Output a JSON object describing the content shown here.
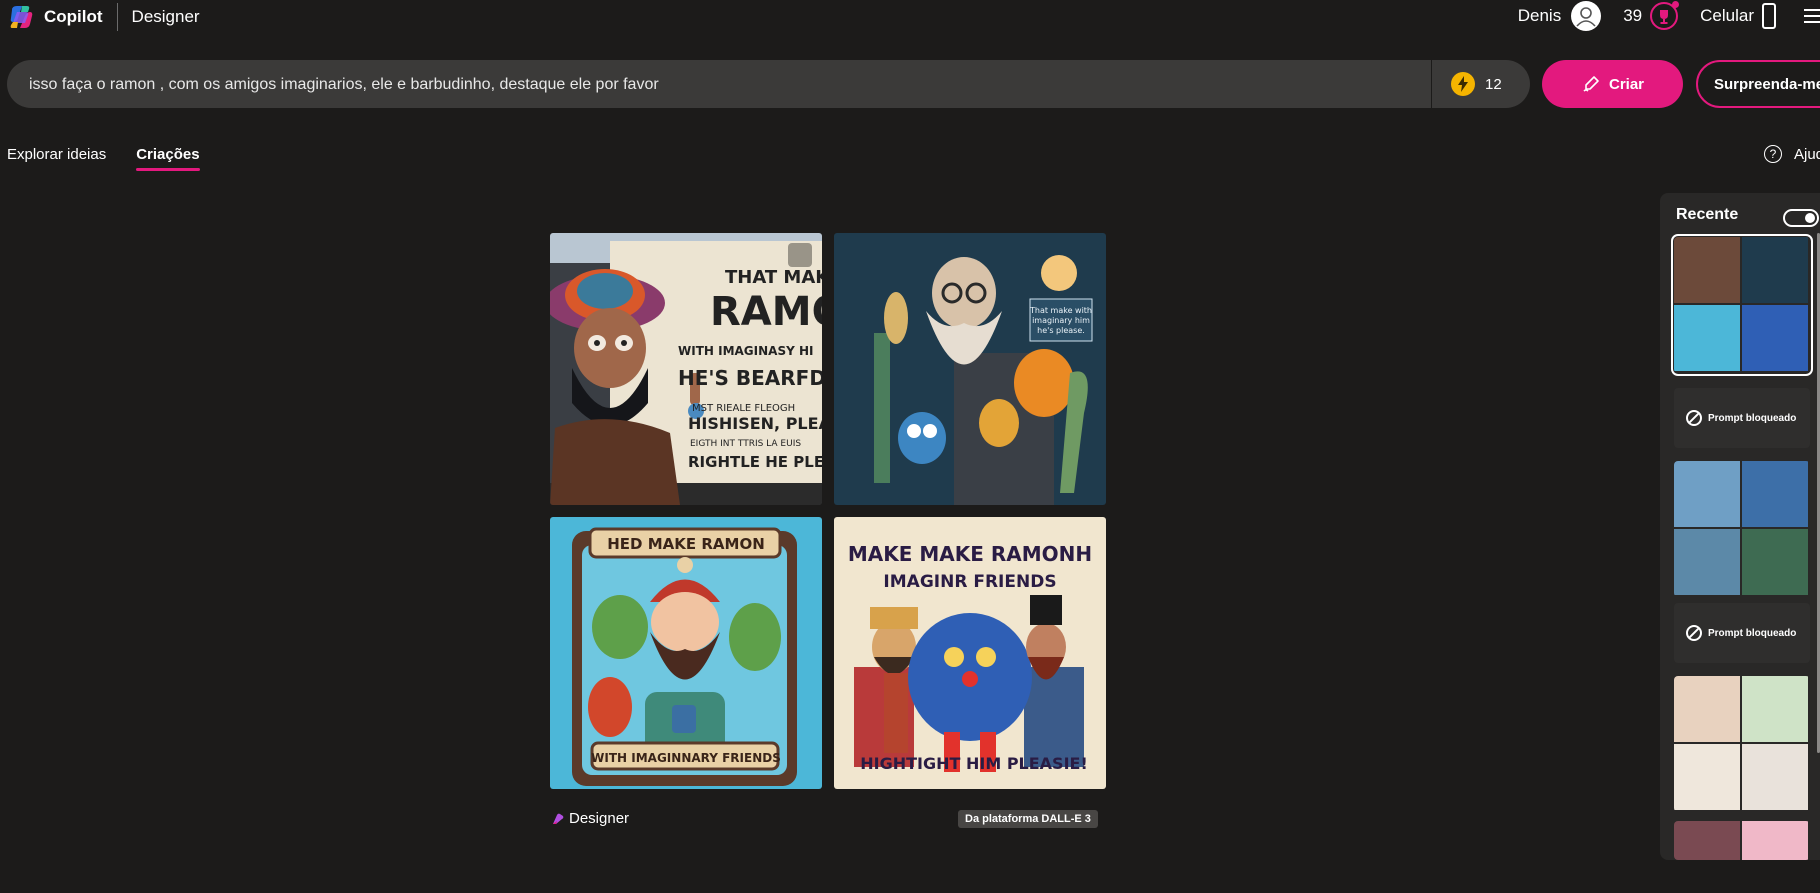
{
  "header": {
    "app_name": "Copilot",
    "app_sub": "Designer",
    "user_name": "Denis",
    "points": "39",
    "mobile_label": "Celular"
  },
  "search": {
    "value": "isso faça o ramon , com os amigos imaginarios, ele e barbudinho, destaque ele por favor",
    "boost_count": "12"
  },
  "actions": {
    "create_label": "Criar",
    "surprise_label": "Surpreenda-me"
  },
  "tabs": [
    {
      "label": "Explorar ideias",
      "active": false
    },
    {
      "label": "Criações",
      "active": true
    }
  ],
  "help_label": "Ajuda",
  "results": {
    "images": [
      {
        "text_lines": [
          "THAT MAKE",
          "RAMON",
          "WITH IMAGINASY HI",
          "HE'S BEARFD",
          "MST RIEALE FLEOGH",
          "HISHISEN, PLEAS",
          "EIGTH INT TTRIS LA EUIS",
          "RIGHTLE HE PLEAS"
        ]
      },
      {
        "text_lines": [
          "That make with",
          "imaginary him",
          "he's please."
        ]
      },
      {
        "text_lines": [
          "HED MAKE RAMON",
          "WITH IMAGINNARY FRIENDS"
        ]
      },
      {
        "text_lines": [
          "MAKE MAKE RAMONH",
          "IMAGINR FRIENDS",
          "HIGHTIGHT HIM PLEASIE!"
        ]
      }
    ],
    "brand_label": "Designer",
    "platform_badge": "Da plataforma DALL-E 3"
  },
  "recent": {
    "title": "Recente",
    "blocked_label": "Prompt bloqueado"
  },
  "colors": {
    "background": "#1c1b1a",
    "accent": "#e3197e",
    "search_bg": "#3b3a39",
    "panel_bg": "#292827"
  }
}
